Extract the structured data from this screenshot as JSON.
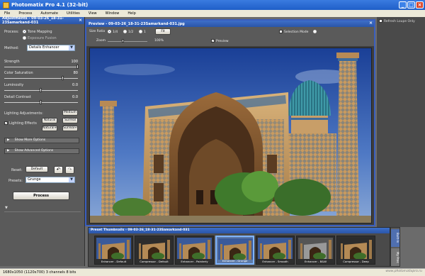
{
  "window": {
    "title": "Photomatix Pro 4.1 (32-bit)"
  },
  "menu": [
    "File",
    "Process",
    "Automate",
    "Utilities",
    "View",
    "Window",
    "Help"
  ],
  "adjustments": {
    "header": "Adjustments - 09-03-26_18-31-23Samarkand-031",
    "process_label": "Process:",
    "process_options": [
      "Tone Mapping",
      "Exposure Fusion"
    ],
    "method_label": "Method:",
    "method_value": "Details Enhancer",
    "sliders": [
      {
        "label": "Strength",
        "value": "100",
        "level": 1.0
      },
      {
        "label": "Color Saturation",
        "value": "80",
        "level": 0.8
      },
      {
        "label": "Luminosity",
        "value": "0.0",
        "level": 0.5
      },
      {
        "label": "Detail Contrast",
        "value": "0.0",
        "level": 0.5
      }
    ],
    "lighting_label": "Lighting Adjustments:",
    "lighting_effects_label": "Lighting Effects",
    "lighting_buttons": [
      "Medium",
      "Natural",
      "Surreal",
      "Natural+",
      "Surreal+"
    ],
    "show_more": "Show More Options",
    "show_advanced": "Show Advanced Options",
    "reset_label": "Reset:",
    "reset_value": "Default",
    "presets_label": "Presets:",
    "presets_value": "Grunge",
    "process_button": "Process"
  },
  "preview": {
    "title": "Preview - 09-03-26_18-31-23Samarkand-031.jpg",
    "size_ratio_label": "Size Ratio",
    "size_ratio_options": [
      "1/4",
      "1/2",
      "1"
    ],
    "fit_button": "Fit",
    "zoom_label": "Zoom",
    "zoom_value": "100%",
    "preview_checkbox": "Preview",
    "selection_mode": "Selection Mode",
    "refresh_loupe": "Refresh Loupe Only"
  },
  "thumbnails": {
    "title": "Preset Thumbnails - 09-03-26_18-31-23Samarkand-031",
    "items": [
      {
        "label": "Enhancer - Default",
        "selected": false
      },
      {
        "label": "Compressor - Default",
        "selected": false
      },
      {
        "label": "Enhancer - Painterly",
        "selected": false
      },
      {
        "label": "Enhancer - Grunge",
        "selected": true
      },
      {
        "label": "Enhancer - Smooth",
        "selected": false
      },
      {
        "label": "Enhancer - B&W",
        "selected": false
      },
      {
        "label": "Compressor - Deep",
        "selected": false
      }
    ]
  },
  "side_tabs": [
    "Built-In",
    "My Pres"
  ],
  "status": {
    "text": "1680x1050 (1120x700) 3 channels 8 bits"
  },
  "watermark": "www.photomatixpro.ru"
}
